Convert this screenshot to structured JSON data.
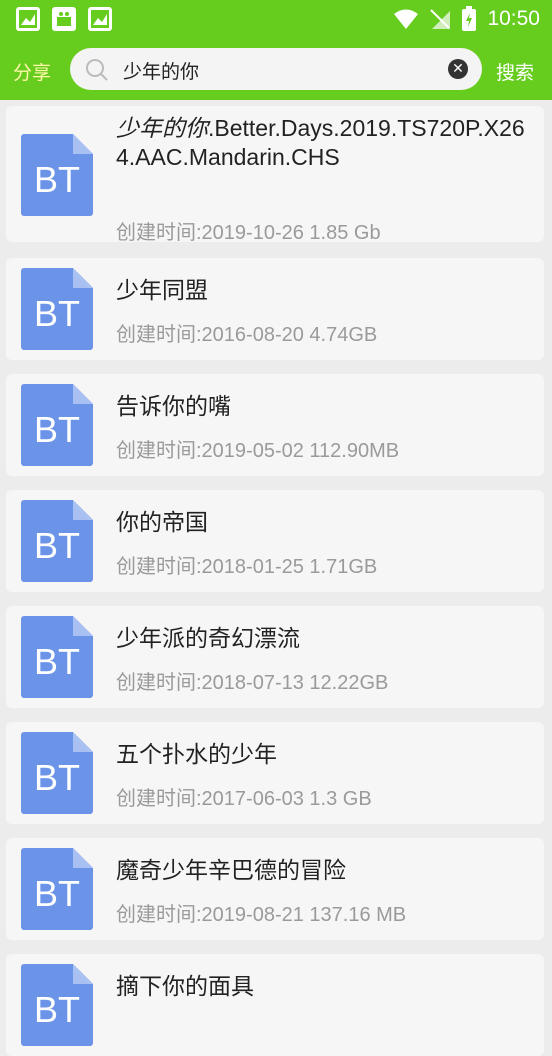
{
  "statusbar": {
    "time": "10:50",
    "notification_icons": [
      "picture-icon",
      "android-store-icon",
      "picture-icon"
    ],
    "system_icons": [
      "wifi-icon",
      "no-sim-icon",
      "battery-charging-icon"
    ]
  },
  "toolbar": {
    "share_label": "分享",
    "search_query": "少年的你",
    "search_label": "搜索"
  },
  "results": [
    {
      "title_highlight": "少年的你",
      "title": ".Better.Days.2019.TS720P.X264.AAC.Mandarin.CHS",
      "meta": "创建时间:2019-10-26 1.85 Gb"
    },
    {
      "title_highlight": "",
      "title": "少年同盟",
      "meta": "创建时间:2016-08-20 4.74GB"
    },
    {
      "title_highlight": "",
      "title": "告诉你的嘴",
      "meta": "创建时间:2019-05-02 112.90MB"
    },
    {
      "title_highlight": "",
      "title": "你的帝国",
      "meta": "创建时间:2018-01-25 1.71GB"
    },
    {
      "title_highlight": "",
      "title": "少年派的奇幻漂流",
      "meta": "创建时间:2018-07-13 12.22GB"
    },
    {
      "title_highlight": "",
      "title": "五个扑水的少年",
      "meta": "创建时间:2017-06-03 1.3 GB"
    },
    {
      "title_highlight": "",
      "title": "魔奇少年辛巴德的冒险",
      "meta": "创建时间:2019-08-21 137.16 MB"
    },
    {
      "title_highlight": "",
      "title": "摘下你的面具",
      "meta": ""
    }
  ],
  "file_icon_label": "BT",
  "colors": {
    "accent": "#66cc1e",
    "icon_blue": "#6b93e8",
    "share_yellow": "#fff8a8"
  }
}
